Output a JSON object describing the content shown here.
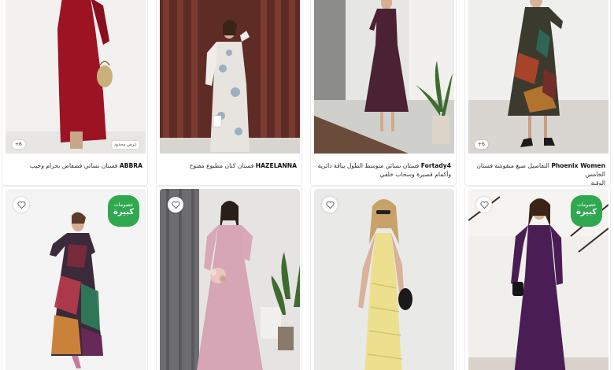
{
  "products": [
    {
      "brand": "ABBRA",
      "name": "فستان نسائي فضفاض بحزام وجيب",
      "image_count": "+6",
      "tag": "عرض محدود"
    },
    {
      "brand": "HAZELANNA",
      "name": "فستان كتان مطبوع مفتوح"
    },
    {
      "brand": "Fortady4",
      "name_line1": "فستان نسائي متوسط الطول بياقة دائرية",
      "name_line2": "وأكمام قصيرة وسحاب خلفي"
    },
    {
      "brand": "Phoenix Women",
      "name_line1": "التفاصيل صبغ منقوشة فستان الخامس",
      "name_line2": "الوقية",
      "image_count": "+6"
    }
  ],
  "bottom_cards": [
    {
      "badge_top": "خصومات",
      "badge_main": "كبيرة",
      "has_badge": true
    },
    {
      "has_badge": false
    },
    {
      "has_badge": false
    },
    {
      "badge_top": "خصومات",
      "badge_main": "كبيرة",
      "has_badge": true
    }
  ],
  "colors": {
    "badge_green": "#2fa84f"
  }
}
